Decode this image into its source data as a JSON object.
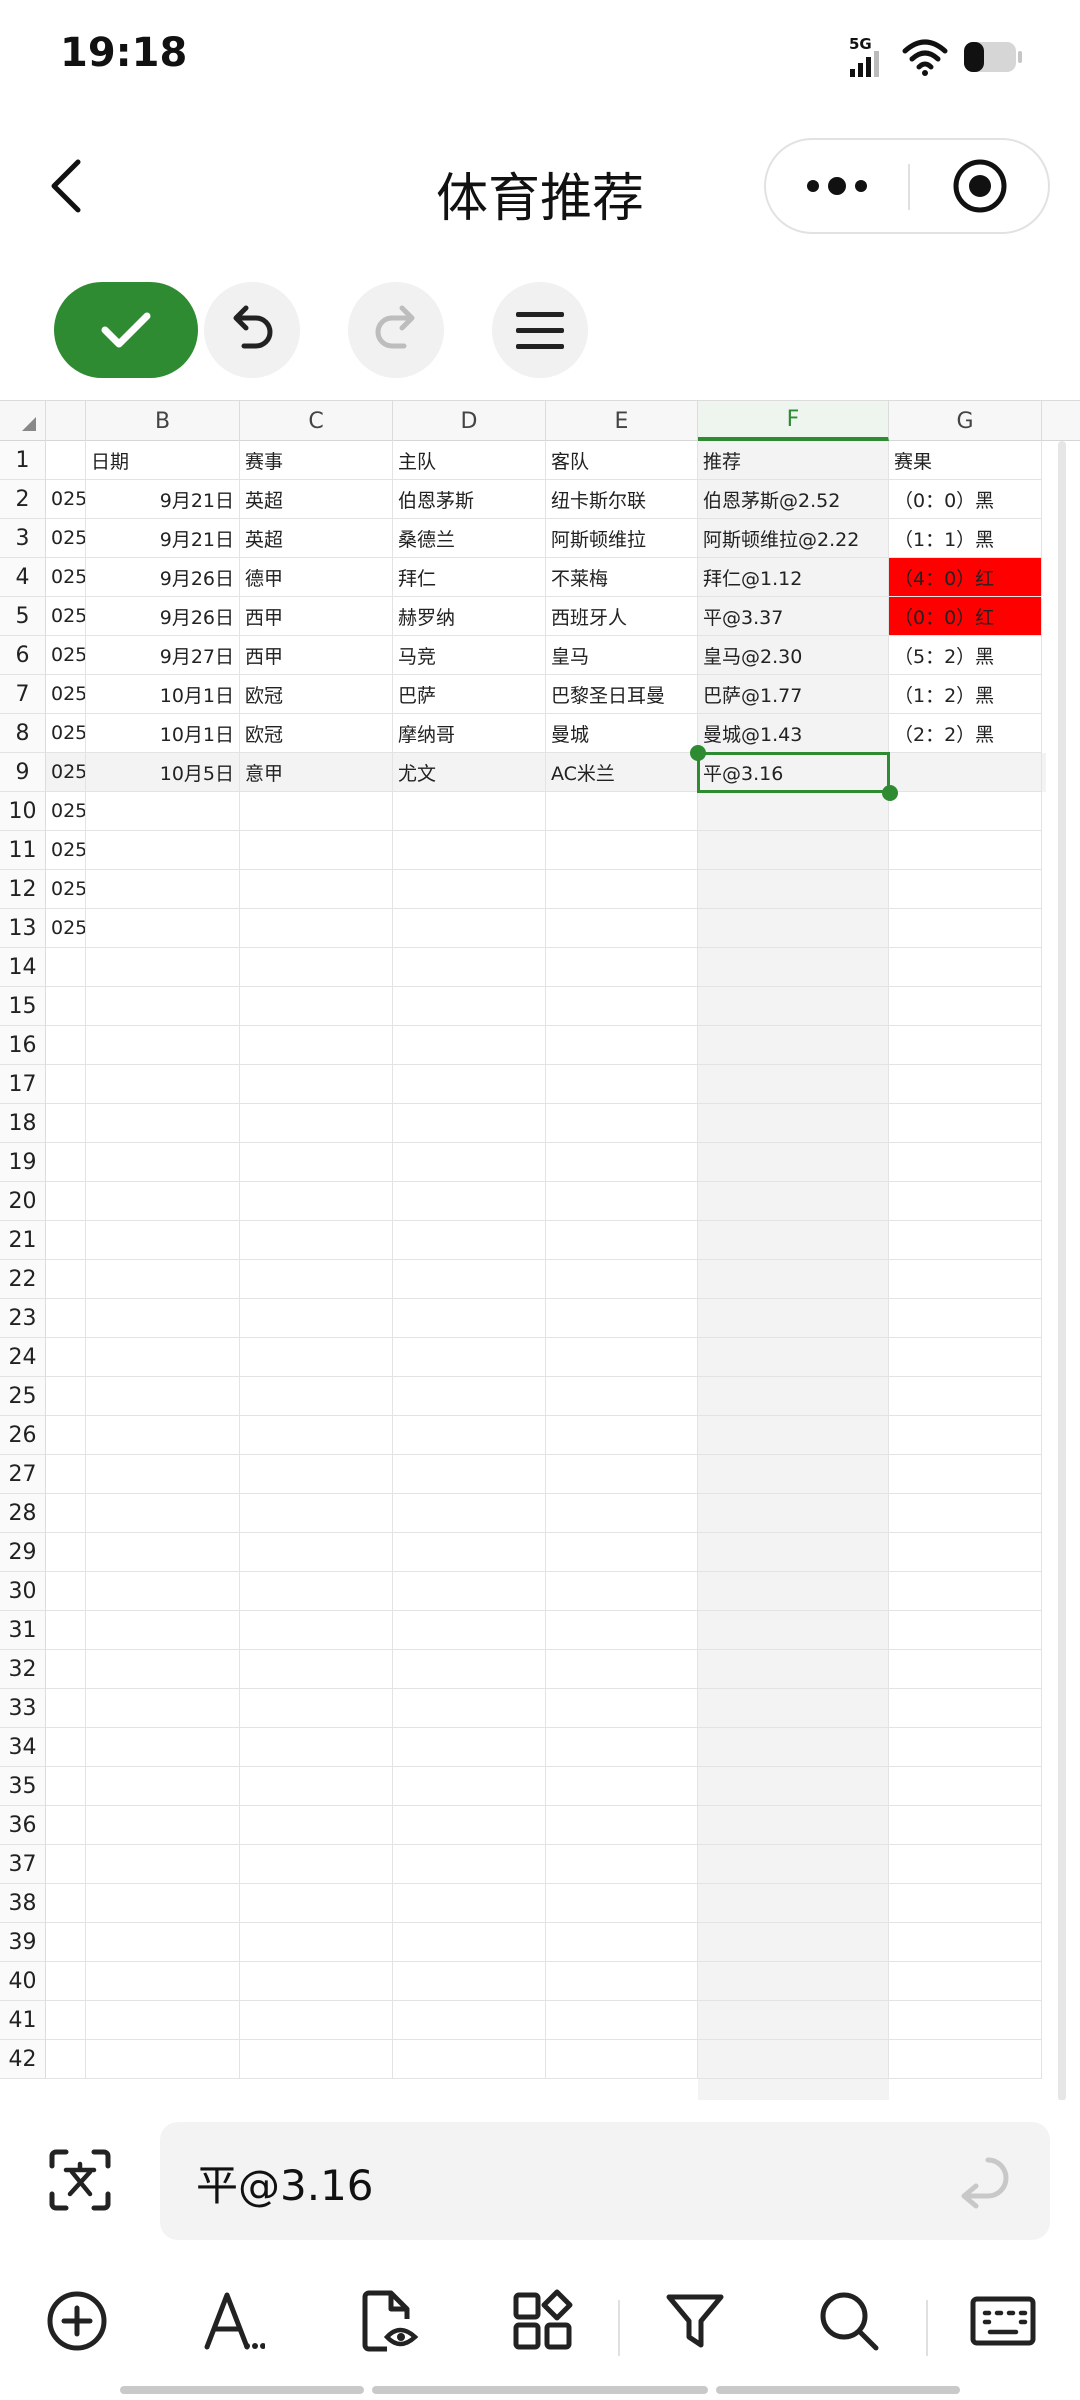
{
  "status_bar": {
    "time": "19:18",
    "network": "5G"
  },
  "header": {
    "title": "体育推荐"
  },
  "columns": [
    "B",
    "C",
    "D",
    "E",
    "F",
    "G"
  ],
  "rows": [
    {
      "num": "1",
      "a": "",
      "b": "日期",
      "c": "赛事",
      "d": "主队",
      "e": "客队",
      "f": "推荐",
      "g": "赛果"
    },
    {
      "num": "2",
      "a": "025",
      "b": "9月21日",
      "c": "英超",
      "d": "伯恩茅斯",
      "e": "纽卡斯尔联",
      "f": "伯恩茅斯@2.52",
      "g": "（0：0）黑"
    },
    {
      "num": "3",
      "a": "025",
      "b": "9月21日",
      "c": "英超",
      "d": "桑德兰",
      "e": "阿斯顿维拉",
      "f": "阿斯顿维拉@2.22",
      "g": "（1：1）黑"
    },
    {
      "num": "4",
      "a": "025",
      "b": "9月26日",
      "c": "德甲",
      "d": "拜仁",
      "e": "不莱梅",
      "f": "拜仁@1.12",
      "g": "（4：0）红"
    },
    {
      "num": "5",
      "a": "025",
      "b": "9月26日",
      "c": "西甲",
      "d": "赫罗纳",
      "e": "西班牙人",
      "f": "平@3.37",
      "g": "（0：0）红"
    },
    {
      "num": "6",
      "a": "025",
      "b": "9月27日",
      "c": "西甲",
      "d": "马竞",
      "e": "皇马",
      "f": "皇马@2.30",
      "g": "（5：2）黑"
    },
    {
      "num": "7",
      "a": "025",
      "b": "10月1日",
      "c": "欧冠",
      "d": "巴萨",
      "e": "巴黎圣日耳曼",
      "f": "巴萨@1.77",
      "g": "（1：2）黑"
    },
    {
      "num": "8",
      "a": "025",
      "b": "10月1日",
      "c": "欧冠",
      "d": "摩纳哥",
      "e": "曼城",
      "f": "曼城@1.43",
      "g": "（2：2）黑"
    },
    {
      "num": "9",
      "a": "025",
      "b": "10月5日",
      "c": "意甲",
      "d": "尤文",
      "e": "AC米兰",
      "f": "平@3.16",
      "g": ""
    },
    {
      "num": "10",
      "a": "025",
      "b": "",
      "c": "",
      "d": "",
      "e": "",
      "f": "",
      "g": ""
    },
    {
      "num": "11",
      "a": "025",
      "b": "",
      "c": "",
      "d": "",
      "e": "",
      "f": "",
      "g": ""
    },
    {
      "num": "12",
      "a": "025",
      "b": "",
      "c": "",
      "d": "",
      "e": "",
      "f": "",
      "g": ""
    },
    {
      "num": "13",
      "a": "025",
      "b": "",
      "c": "",
      "d": "",
      "e": "",
      "f": "",
      "g": ""
    }
  ],
  "empty_rows": [
    "14",
    "15",
    "16",
    "17",
    "18",
    "19",
    "20",
    "21",
    "22",
    "23",
    "24",
    "25",
    "26",
    "27",
    "28",
    "29",
    "30",
    "31",
    "32",
    "33",
    "34",
    "35",
    "36",
    "37",
    "38",
    "39",
    "40",
    "41",
    "42"
  ],
  "highlighted_cells": [
    "G4",
    "G5"
  ],
  "selected_cell": "F9",
  "colors": {
    "accent": "#2e8b32",
    "highlight": "#ff0000"
  },
  "formula_bar": {
    "value": "平@3.16"
  },
  "bottom_toolbar": [
    "insert-icon",
    "font-style-icon",
    "view-file-icon",
    "apps-icon",
    "filter-icon",
    "search-icon",
    "keyboard-icon"
  ]
}
